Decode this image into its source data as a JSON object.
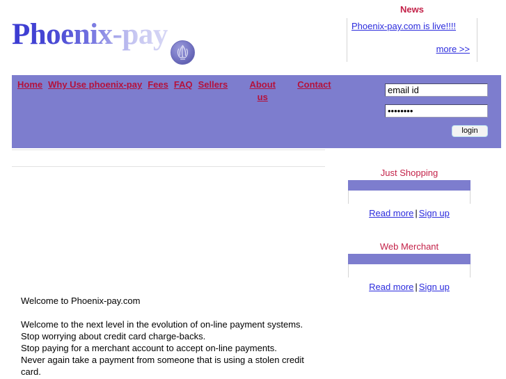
{
  "brand": {
    "wordmark": "Phoenix-pay",
    "badge_icon": "phoenix-flame-emblem-icon"
  },
  "news": {
    "title": "News",
    "headline": "Phoenix-pay.com is live!!!!",
    "more_label": "more >>"
  },
  "nav": {
    "items": [
      {
        "label": "Home"
      },
      {
        "label": "Why Use phoenix-pay"
      },
      {
        "label": "Fees"
      },
      {
        "label": "FAQ"
      },
      {
        "label": "Sellers"
      },
      {
        "label": "About us"
      },
      {
        "label": "Contact"
      }
    ]
  },
  "login": {
    "email_value": "email id",
    "email_placeholder": "email id",
    "password_value": "••••••••",
    "password_placeholder": "",
    "button_label": "login"
  },
  "promos": [
    {
      "title": "Just Shopping",
      "read_more_label": "Read more",
      "separator": "|",
      "sign_up_label": "Sign up"
    },
    {
      "title": "Web Merchant",
      "read_more_label": "Read more",
      "separator": "|",
      "sign_up_label": "Sign up"
    }
  ],
  "main": {
    "heading": "Welcome to Phoenix-pay.com",
    "paragraph_lines": [
      "Welcome to the next level in the evolution of on-line payment systems.",
      "Stop worrying about credit card charge-backs.",
      "Stop paying for a merchant account to accept on-line payments.",
      "Never again take a payment from someone that is using a stolen credit",
      "card."
    ]
  },
  "colors": {
    "purple": "#7d7dce",
    "crimson": "#c32148",
    "nav_link": "#b4123c",
    "link_blue": "#2b2bdd",
    "rule_gray": "#e2e2e2"
  }
}
